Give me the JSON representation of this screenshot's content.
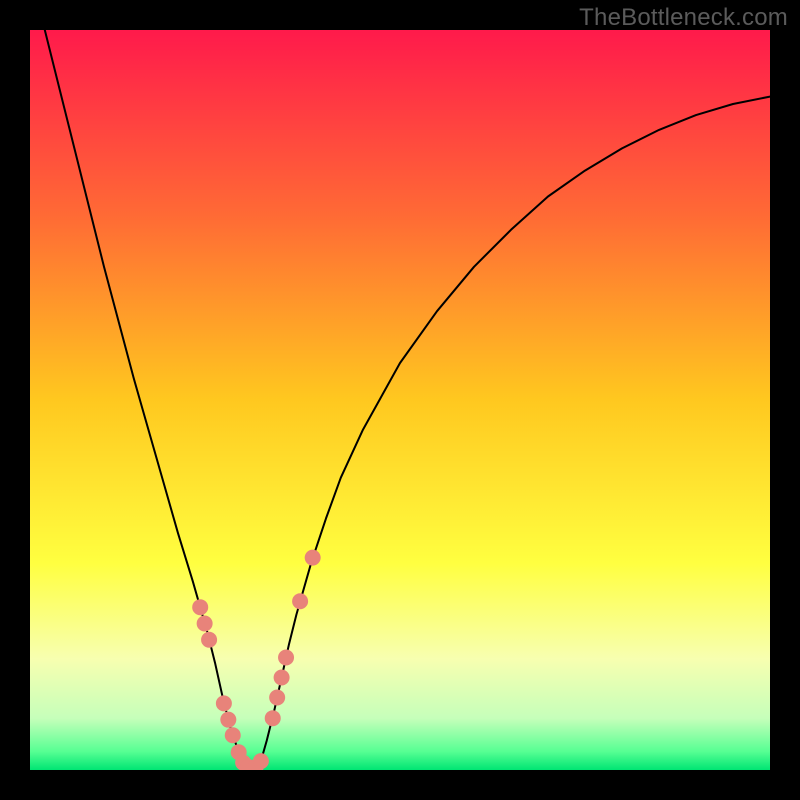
{
  "watermark": "TheBottleneck.com",
  "chart_data": {
    "type": "line",
    "title": "",
    "xlabel": "",
    "ylabel": "",
    "xlim": [
      0,
      100
    ],
    "ylim": [
      0,
      100
    ],
    "grid": false,
    "legend": false,
    "background_gradient": {
      "stops": [
        {
          "offset": 0.0,
          "color": "#ff1a4b"
        },
        {
          "offset": 0.25,
          "color": "#ff6a35"
        },
        {
          "offset": 0.5,
          "color": "#ffc81f"
        },
        {
          "offset": 0.72,
          "color": "#ffff40"
        },
        {
          "offset": 0.85,
          "color": "#f7ffb0"
        },
        {
          "offset": 0.93,
          "color": "#c6ffba"
        },
        {
          "offset": 0.975,
          "color": "#57ff93"
        },
        {
          "offset": 1.0,
          "color": "#00e573"
        }
      ]
    },
    "series": [
      {
        "name": "left-curve",
        "stroke": "#000000",
        "stroke_width": 2.0,
        "x": [
          2,
          4,
          6,
          8,
          10,
          12,
          14,
          16,
          18,
          20,
          22,
          23,
          24,
          25,
          26,
          27,
          28,
          29
        ],
        "y": [
          100,
          92,
          84,
          76,
          68,
          60.5,
          53,
          46,
          39,
          32,
          25.5,
          22,
          18.5,
          14.5,
          10,
          6,
          3,
          0.5
        ]
      },
      {
        "name": "right-curve",
        "stroke": "#000000",
        "stroke_width": 2.0,
        "x": [
          31,
          32,
          33,
          34,
          35,
          36,
          38,
          40,
          42,
          45,
          50,
          55,
          60,
          65,
          70,
          75,
          80,
          85,
          90,
          95,
          100
        ],
        "y": [
          0.5,
          4,
          8,
          12.5,
          17,
          21,
          28,
          34,
          39.5,
          46,
          55,
          62,
          68,
          73,
          77.5,
          81,
          84,
          86.5,
          88.5,
          90,
          91
        ]
      },
      {
        "name": "valley-flat",
        "stroke": "#000000",
        "stroke_width": 2.0,
        "x": [
          29,
          30,
          31
        ],
        "y": [
          0.5,
          0.3,
          0.5
        ]
      }
    ],
    "scatter": [
      {
        "name": "marker-dots",
        "color": "#e8837a",
        "radius": 8,
        "points": [
          {
            "x": 23.0,
            "y": 22.0
          },
          {
            "x": 23.6,
            "y": 19.8
          },
          {
            "x": 24.2,
            "y": 17.6
          },
          {
            "x": 26.2,
            "y": 9.0
          },
          {
            "x": 26.8,
            "y": 6.8
          },
          {
            "x": 27.4,
            "y": 4.7
          },
          {
            "x": 28.2,
            "y": 2.4
          },
          {
            "x": 28.8,
            "y": 1.0
          },
          {
            "x": 29.5,
            "y": 0.4
          },
          {
            "x": 30.5,
            "y": 0.4
          },
          {
            "x": 31.2,
            "y": 1.2
          },
          {
            "x": 32.8,
            "y": 7.0
          },
          {
            "x": 33.4,
            "y": 9.8
          },
          {
            "x": 34.0,
            "y": 12.5
          },
          {
            "x": 34.6,
            "y": 15.2
          },
          {
            "x": 36.5,
            "y": 22.8
          },
          {
            "x": 38.2,
            "y": 28.7
          }
        ]
      }
    ]
  }
}
